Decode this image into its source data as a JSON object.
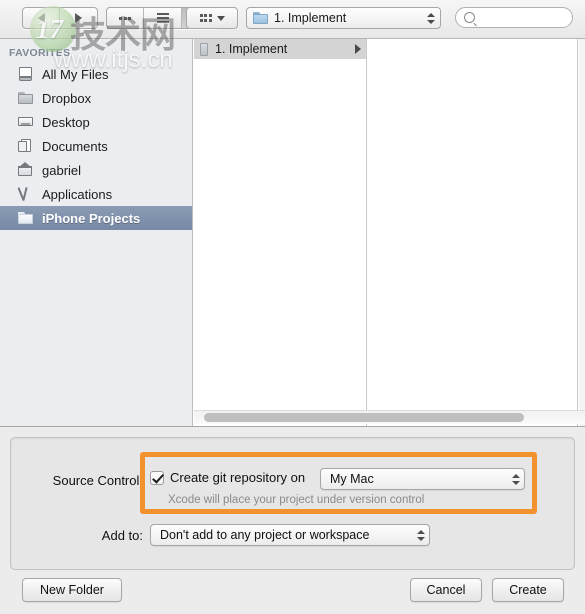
{
  "toolbar": {
    "back_icon": "back-arrow-icon",
    "forward_icon": "forward-arrow-icon",
    "view_icon_label": "icon-view-icon",
    "view_list_label": "list-view-icon",
    "view_column_label": "column-view-icon",
    "arrange_icon": "arrange-grid-icon",
    "arrange_caret": "chevron-down-icon",
    "path_popup_value": "1. Implement",
    "path_folder_icon": "folder-icon",
    "search_placeholder": "",
    "search_value": "",
    "search_icon": "search-icon"
  },
  "sidebar": {
    "header": "FAVORITES",
    "items": [
      {
        "label": "All My Files",
        "icon": "all-my-files-icon",
        "selected": false
      },
      {
        "label": "Dropbox",
        "icon": "folder-icon",
        "selected": false
      },
      {
        "label": "Desktop",
        "icon": "desktop-icon",
        "selected": false
      },
      {
        "label": "Documents",
        "icon": "documents-icon",
        "selected": false
      },
      {
        "label": "gabriel",
        "icon": "home-icon",
        "selected": false
      },
      {
        "label": "Applications",
        "icon": "applications-icon",
        "selected": false
      },
      {
        "label": "iPhone Projects",
        "icon": "folder-icon",
        "selected": true
      }
    ]
  },
  "browser": {
    "column1": [
      {
        "label": "1. Implement",
        "selected": true,
        "has_children": true
      }
    ],
    "column2": []
  },
  "accessory": {
    "source_control_label": "Source Control:",
    "git_checkbox_label": "Create git repository on",
    "git_checkbox_checked": true,
    "git_location_value": "My Mac",
    "git_hint": "Xcode will place your project under version control",
    "add_to_label": "Add to:",
    "add_to_value": "Don't add to any project or workspace",
    "highlight_color": "#f2922e"
  },
  "buttons": {
    "new_folder": "New Folder",
    "cancel": "Cancel",
    "create": "Create"
  },
  "watermark": {
    "logo_number": "17",
    "brand": "技术网",
    "url": "www.itjs.cn"
  }
}
